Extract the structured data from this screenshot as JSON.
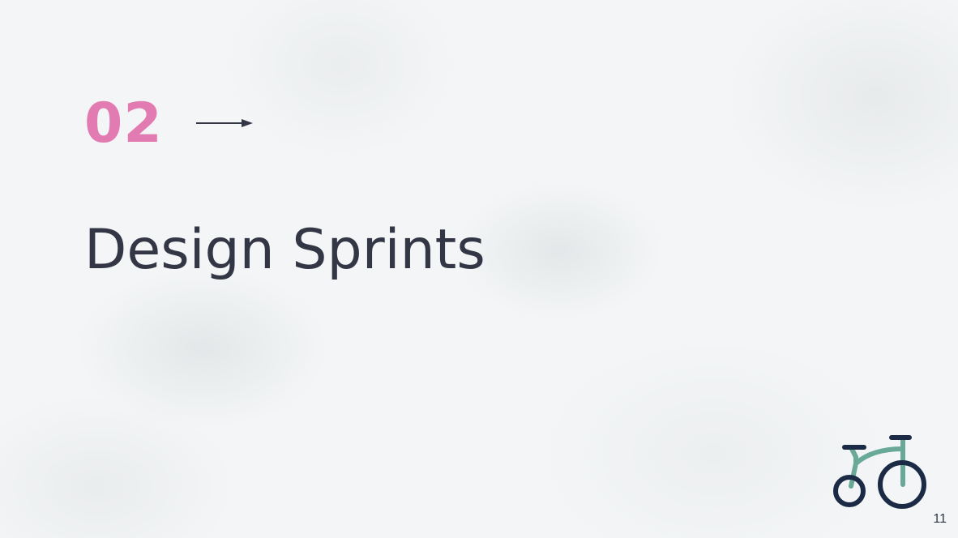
{
  "slide": {
    "section_number": "02",
    "title": "Design Sprints",
    "page_number": "11",
    "icons": {
      "arrow": "right-arrow-icon",
      "logo": "tricycle-icon"
    },
    "colors": {
      "accent_pink": "#e27bb1",
      "title_text": "#333645",
      "logo_navy": "#1b2a45",
      "logo_teal": "#6aa898"
    }
  }
}
